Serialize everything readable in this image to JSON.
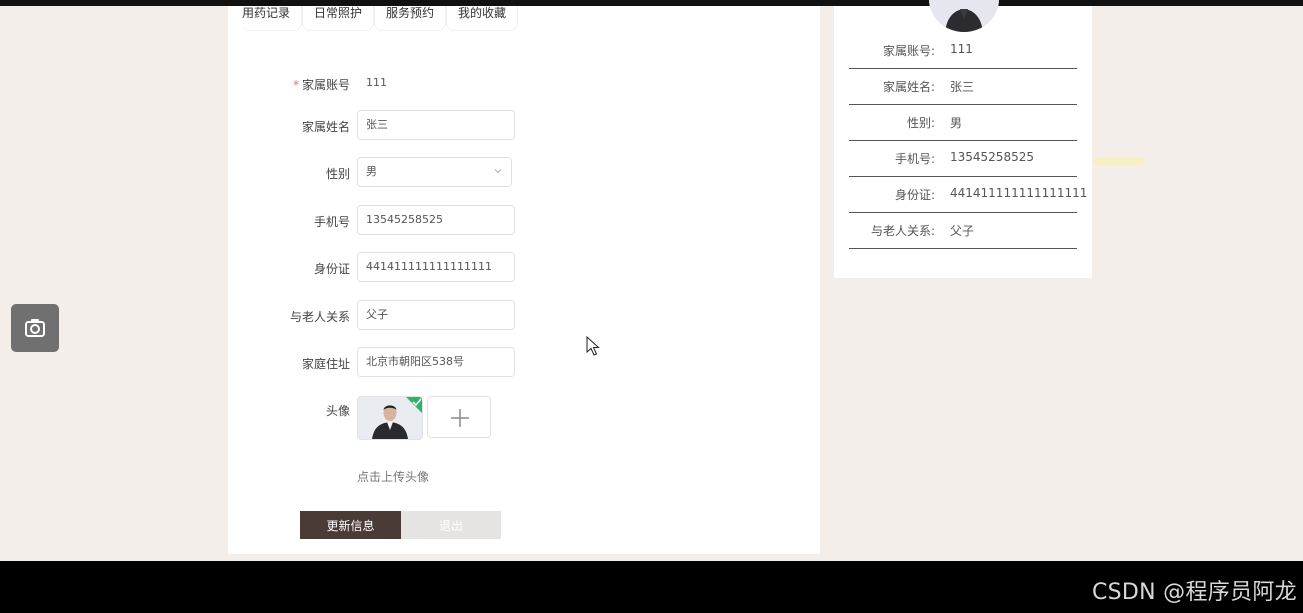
{
  "tabs": [
    "用药记录",
    "日常照护",
    "服务预约",
    "我的收藏"
  ],
  "form": {
    "account": {
      "label": "家属账号",
      "value": "111"
    },
    "name": {
      "label": "家属姓名",
      "value": "张三"
    },
    "gender": {
      "label": "性别",
      "value": "男"
    },
    "phone": {
      "label": "手机号",
      "value": "13545258525"
    },
    "idcard": {
      "label": "身份证",
      "value": "441411111111111111"
    },
    "relation": {
      "label": "与老人关系",
      "value": "父子"
    },
    "address": {
      "label": "家庭住址",
      "value": "北京市朝阳区538号"
    },
    "avatar": {
      "label": "头像",
      "hint": "点击上传头像"
    },
    "buttons": {
      "update": "更新信息",
      "exit": "退出"
    }
  },
  "info": [
    {
      "label": "家属账号:",
      "value": "111"
    },
    {
      "label": "家属姓名:",
      "value": "张三"
    },
    {
      "label": "性别:",
      "value": "男"
    },
    {
      "label": "手机号:",
      "value": "13545258525"
    },
    {
      "label": "身份证:",
      "value": "441411111111111111"
    },
    {
      "label": "与老人关系:",
      "value": "父子"
    }
  ],
  "watermark": "CSDN @程序员阿龙",
  "colors": {
    "primary": "#4a3b37",
    "check": "#2fb36b",
    "background": "#f3eeea"
  }
}
